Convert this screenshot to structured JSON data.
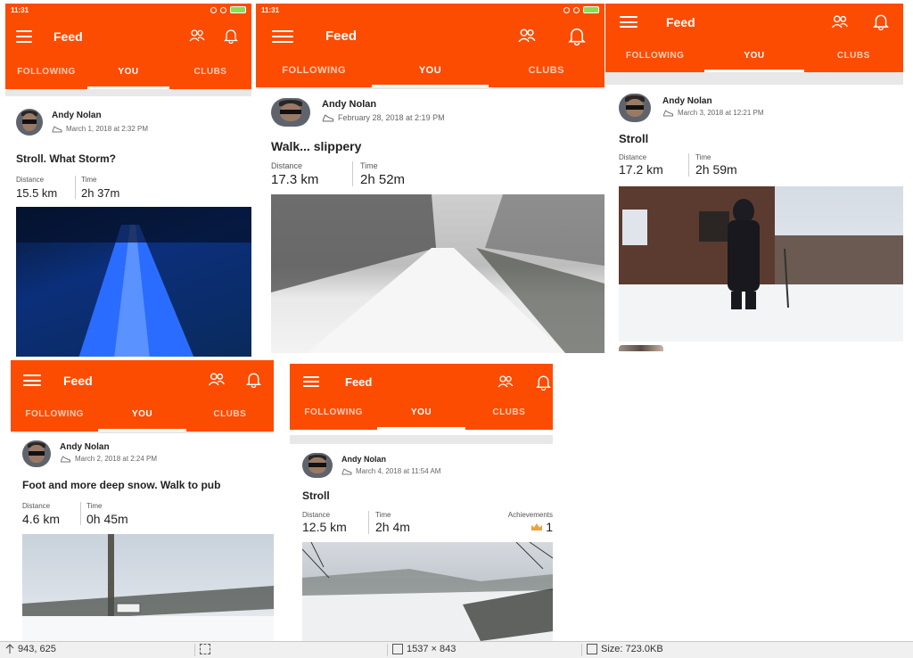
{
  "colors": {
    "brand": "#fc4c02",
    "tab_active": "#ffffff",
    "tab_inactive": "#ffd2bd"
  },
  "app": {
    "title": "Feed",
    "tabs": {
      "following": "FOLLOWING",
      "you": "YOU",
      "clubs": "CLUBS"
    },
    "icons": {
      "menu": "hamburger-menu-icon",
      "people": "people-icon",
      "bell": "bell-icon",
      "activity": "shoe-icon"
    }
  },
  "status_bar": {
    "clock": "11:31"
  },
  "activities": [
    {
      "name": "Andy Nolan",
      "date": "March 1, 2018 at 2:32 PM",
      "title": "Stroll. What Storm?",
      "distance_label": "Distance",
      "distance": "15.5 km",
      "time_label": "Time",
      "time": "2h 37m"
    },
    {
      "name": "Andy Nolan",
      "date": "February 28, 2018 at 2:19 PM",
      "title": "Walk... slippery",
      "distance_label": "Distance",
      "distance": "17.3 km",
      "time_label": "Time",
      "time": "2h 52m"
    },
    {
      "name": "Andy Nolan",
      "date": "March 3, 2018 at 12:21 PM",
      "title": "Stroll",
      "distance_label": "Distance",
      "distance": "17.2 km",
      "time_label": "Time",
      "time": "2h 59m"
    },
    {
      "name": "Andy Nolan",
      "date": "March 2, 2018 at 2:24 PM",
      "title": "Foot and more deep snow. Walk to pub",
      "distance_label": "Distance",
      "distance": "4.6 km",
      "time_label": "Time",
      "time": "0h 45m"
    },
    {
      "name": "Andy Nolan",
      "date": "March 4, 2018 at 11:54 AM",
      "title": "Stroll",
      "distance_label": "Distance",
      "distance": "12.5 km",
      "time_label": "Time",
      "time": "2h 4m",
      "achievements_label": "Achievements",
      "achievements": "1"
    }
  ],
  "viewer_status": {
    "cursor": "943, 625",
    "selection": "",
    "dimensions": "1537 × 843",
    "size": "Size: 723.0KB",
    "icons": [
      "cursor-position-icon",
      "selection-icon",
      "dimensions-icon",
      "file-size-icon"
    ]
  }
}
